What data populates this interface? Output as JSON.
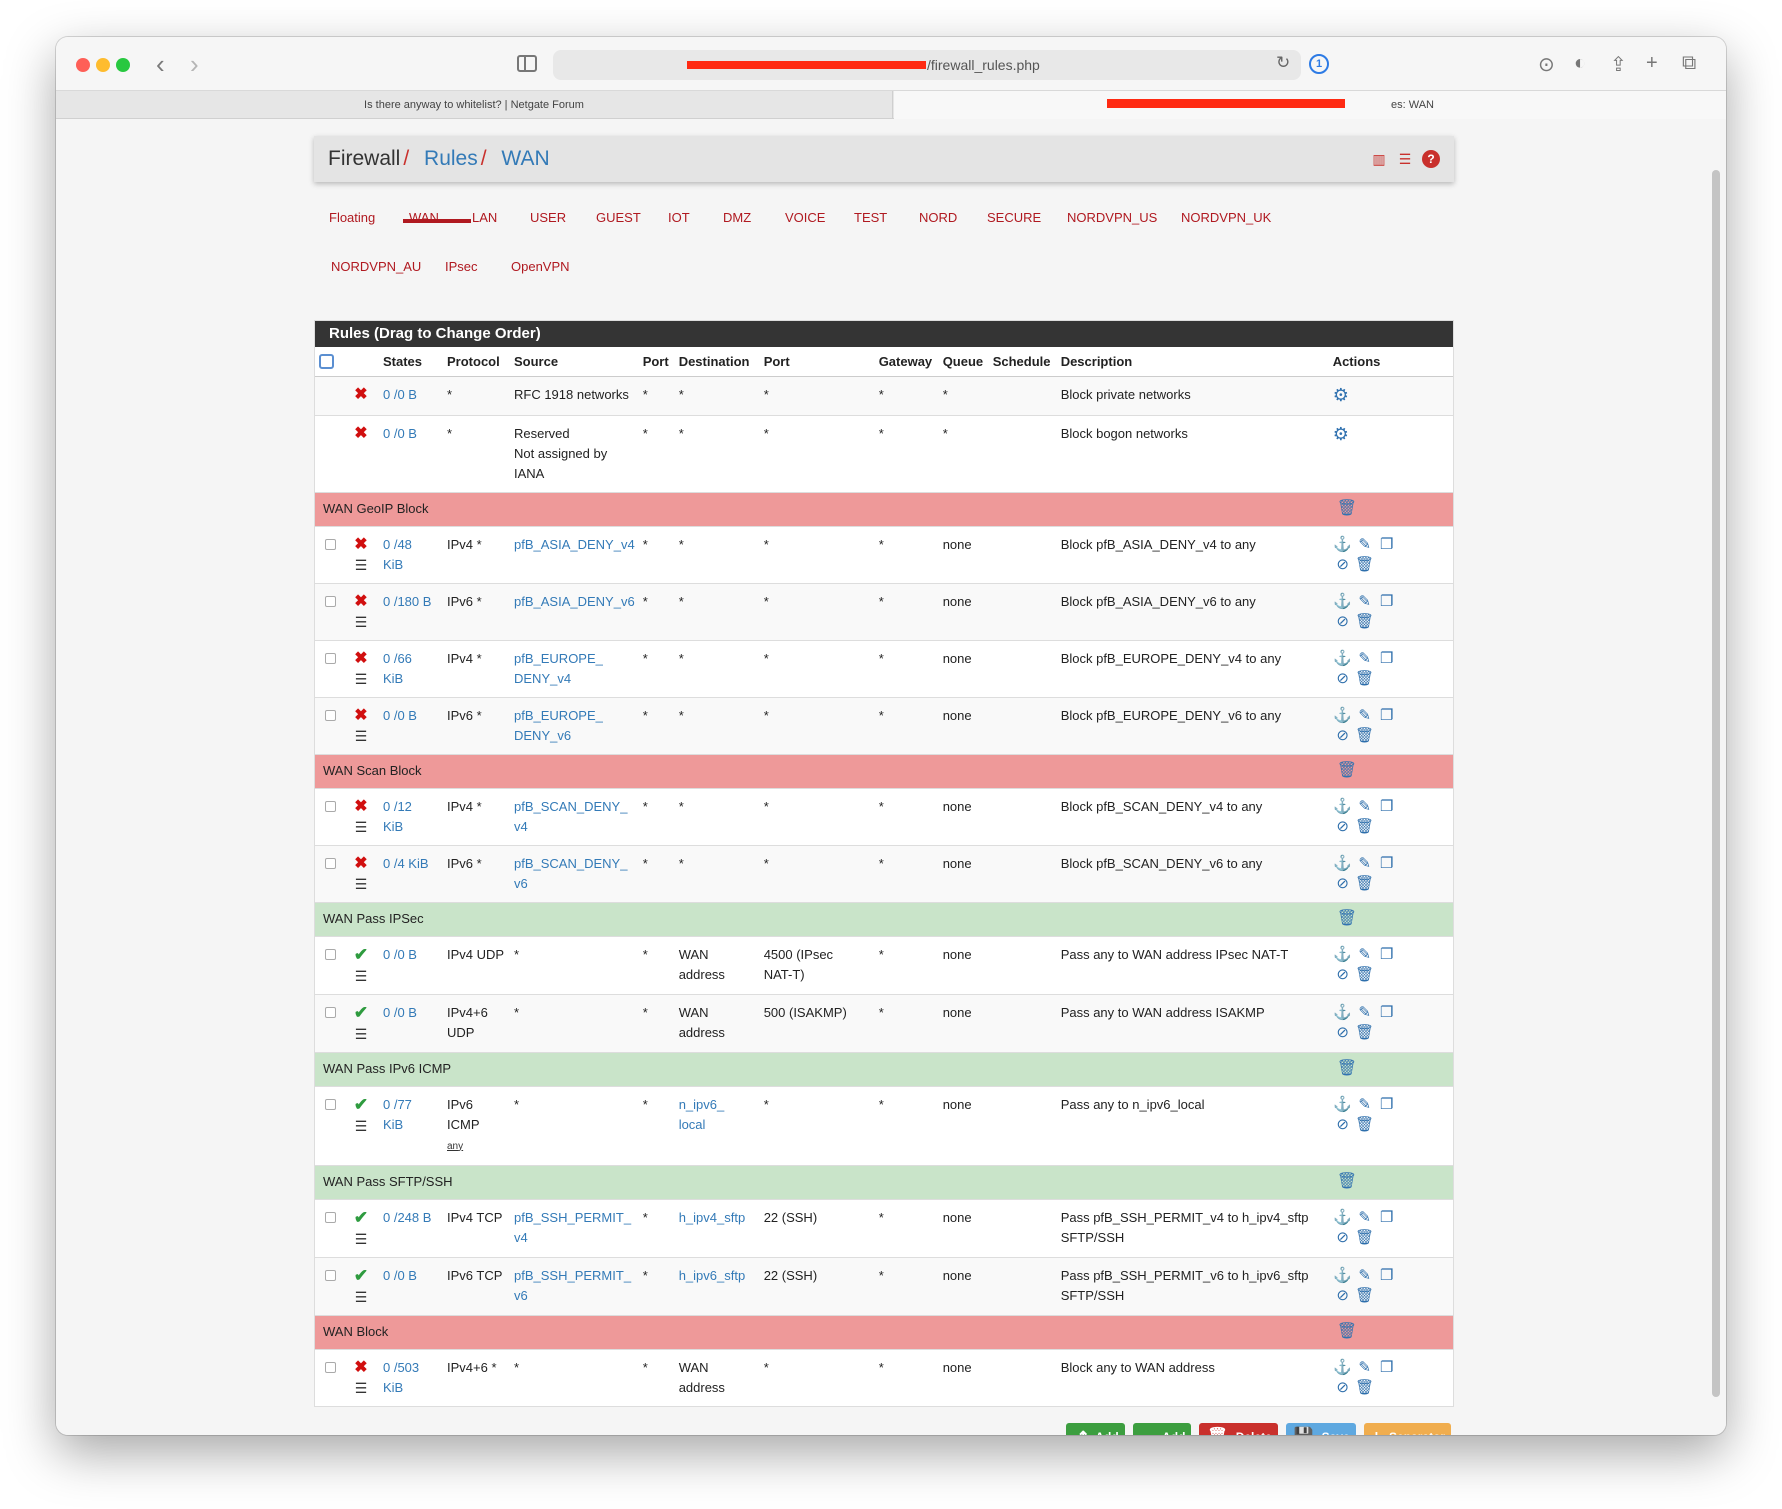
{
  "browser": {
    "url_visible": "/firewall_rules.php",
    "tab_inactive": "Is there anyway to whitelist? | Netgate Forum",
    "tab_active_suffix": "es: WAN"
  },
  "breadcrumb": {
    "root": "Firewall",
    "sep": "/",
    "level2": "Rules",
    "level3": "WAN"
  },
  "tabs": [
    "Floating",
    "WAN",
    "LAN",
    "USER",
    "GUEST",
    "IOT",
    "DMZ",
    "VOICE",
    "TEST",
    "NORD",
    "SECURE",
    "NORDVPN_US",
    "NORDVPN_UK",
    "NORDVPN_AU",
    "IPsec",
    "OpenVPN"
  ],
  "panel_title": "Rules (Drag to Change Order)",
  "columns": [
    "States",
    "Protocol",
    "Source",
    "Port",
    "Destination",
    "Port",
    "Gateway",
    "Queue",
    "Schedule",
    "Description",
    "Actions"
  ],
  "fixed_rules": [
    {
      "states": "0 /0 B",
      "protocol": "*",
      "source": "RFC 1918 networks",
      "sport": "*",
      "dest": "*",
      "dport": "*",
      "gateway": "*",
      "queue": "*",
      "desc": "Block private networks"
    },
    {
      "states": "0 /0 B",
      "protocol": "*",
      "source": "Reserved\nNot assigned by\nIANA",
      "sport": "*",
      "dest": "*",
      "dport": "*",
      "gateway": "*",
      "queue": "*",
      "desc": "Block bogon networks"
    }
  ],
  "sections": [
    {
      "title": "WAN GeoIP Block",
      "color": "red",
      "rules": [
        {
          "type": "block",
          "states": "0 /48\nKiB",
          "protocol": "IPv4 *",
          "source": "pfB_ASIA_DENY_v4",
          "sport": "*",
          "dest": "*",
          "dport": "*",
          "gateway": "*",
          "queue": "none",
          "desc": "Block pfB_ASIA_DENY_v4 to any"
        },
        {
          "type": "block",
          "states": "0 /180 B",
          "protocol": "IPv6 *",
          "source": "pfB_ASIA_DENY_v6",
          "sport": "*",
          "dest": "*",
          "dport": "*",
          "gateway": "*",
          "queue": "none",
          "desc": "Block pfB_ASIA_DENY_v6 to any"
        },
        {
          "type": "block",
          "states": "0 /66\nKiB",
          "protocol": "IPv4 *",
          "source": "pfB_EUROPE_\nDENY_v4",
          "sport": "*",
          "dest": "*",
          "dport": "*",
          "gateway": "*",
          "queue": "none",
          "desc": "Block pfB_EUROPE_DENY_v4 to any"
        },
        {
          "type": "block",
          "states": "0 /0 B",
          "protocol": "IPv6 *",
          "source": "pfB_EUROPE_\nDENY_v6",
          "sport": "*",
          "dest": "*",
          "dport": "*",
          "gateway": "*",
          "queue": "none",
          "desc": "Block pfB_EUROPE_DENY_v6 to any"
        }
      ]
    },
    {
      "title": "WAN Scan Block",
      "color": "red",
      "rules": [
        {
          "type": "block",
          "states": "0 /12\nKiB",
          "protocol": "IPv4 *",
          "source": "pfB_SCAN_DENY_\nv4",
          "sport": "*",
          "dest": "*",
          "dport": "*",
          "gateway": "*",
          "queue": "none",
          "desc": "Block pfB_SCAN_DENY_v4 to any"
        },
        {
          "type": "block",
          "states": "0 /4 KiB",
          "protocol": "IPv6 *",
          "source": "pfB_SCAN_DENY_\nv6",
          "sport": "*",
          "dest": "*",
          "dport": "*",
          "gateway": "*",
          "queue": "none",
          "desc": "Block pfB_SCAN_DENY_v6 to any"
        }
      ]
    },
    {
      "title": "WAN Pass IPSec",
      "color": "green",
      "rules": [
        {
          "type": "pass",
          "states": "0 /0 B",
          "protocol": "IPv4 UDP",
          "source": "*",
          "sport": "*",
          "dest": "WAN\naddress",
          "dport": "4500 (IPsec\nNAT-T)",
          "gateway": "*",
          "queue": "none",
          "desc": "Pass any to WAN address IPsec NAT-T"
        },
        {
          "type": "pass",
          "states": "0 /0 B",
          "protocol": "IPv4+6\nUDP",
          "source": "*",
          "sport": "*",
          "dest": "WAN\naddress",
          "dport": "500 (ISAKMP)",
          "gateway": "*",
          "queue": "none",
          "desc": "Pass any to WAN address ISAKMP"
        }
      ]
    },
    {
      "title": "WAN Pass IPv6 ICMP",
      "color": "green",
      "rules": [
        {
          "type": "pass",
          "states": "0 /77\nKiB",
          "protocol": "IPv6\nICMP",
          "protocol_sub": "any",
          "source": "*",
          "sport": "*",
          "dest": "n_ipv6_\nlocal",
          "dport": "*",
          "gateway": "*",
          "queue": "none",
          "desc": "Pass any to n_ipv6_local"
        }
      ]
    },
    {
      "title": "WAN Pass SFTP/SSH",
      "color": "green",
      "rules": [
        {
          "type": "pass",
          "states": "0 /248 B",
          "protocol": "IPv4 TCP",
          "source": "pfB_SSH_PERMIT_\nv4",
          "sport": "*",
          "dest": "h_ipv4_sftp",
          "dport": "22 (SSH)",
          "gateway": "*",
          "queue": "none",
          "desc": "Pass pfB_SSH_PERMIT_v4 to h_ipv4_sftp\nSFTP/SSH"
        },
        {
          "type": "pass",
          "states": "0 /0 B",
          "protocol": "IPv6 TCP",
          "source": "pfB_SSH_PERMIT_\nv6",
          "sport": "*",
          "dest": "h_ipv6_sftp",
          "dport": "22 (SSH)",
          "gateway": "*",
          "queue": "none",
          "desc": "Pass pfB_SSH_PERMIT_v6 to h_ipv6_sftp\nSFTP/SSH"
        }
      ]
    },
    {
      "title": "WAN Block",
      "color": "red",
      "rules": [
        {
          "type": "block",
          "states": "0 /503\nKiB",
          "protocol": "IPv4+6 *",
          "source": "*",
          "sport": "*",
          "dest": "WAN\naddress",
          "dport": "*",
          "gateway": "*",
          "queue": "none",
          "desc": "Block any to WAN address"
        }
      ]
    }
  ],
  "buttons": {
    "add_top": "Add",
    "add_bottom": "Add",
    "delete": "Delete",
    "save": "Save",
    "separator": "Separator"
  },
  "colors": {
    "sep_red": "#ee9999",
    "sep_green": "#c9e4c9",
    "accent_red": "#b01920",
    "link_blue": "#337ab7"
  }
}
